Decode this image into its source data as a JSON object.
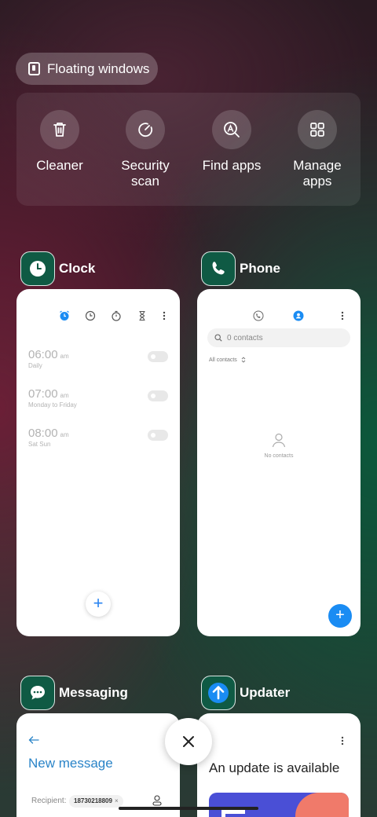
{
  "floating_windows": {
    "label": "Floating windows"
  },
  "quick_actions": [
    {
      "label": "Cleaner",
      "icon": "trash-icon"
    },
    {
      "label": "Security scan",
      "icon": "shield-scan-icon"
    },
    {
      "label": "Find apps",
      "icon": "find-apps-icon"
    },
    {
      "label": "Manage apps",
      "icon": "grid-icon"
    }
  ],
  "apps": {
    "clock": {
      "name": "Clock",
      "alarms": [
        {
          "time": "06:00",
          "ampm": "am",
          "repeat": "Daily"
        },
        {
          "time": "07:00",
          "ampm": "am",
          "repeat": "Monday to Friday"
        },
        {
          "time": "08:00",
          "ampm": "am",
          "repeat": "Sat Sun"
        }
      ],
      "fab": "+"
    },
    "phone": {
      "name": "Phone",
      "search_placeholder": "0 contacts",
      "filter": "All contacts",
      "empty": "No contacts",
      "fab": "+"
    },
    "messaging": {
      "name": "Messaging",
      "title": "New message",
      "recipient_label": "Recipient:",
      "recipient_chip": "18730218809"
    },
    "updater": {
      "name": "Updater",
      "title": "An update is available"
    }
  },
  "colors": {
    "accent": "#1a8cf3",
    "icon_bg": "#0f5a44"
  }
}
